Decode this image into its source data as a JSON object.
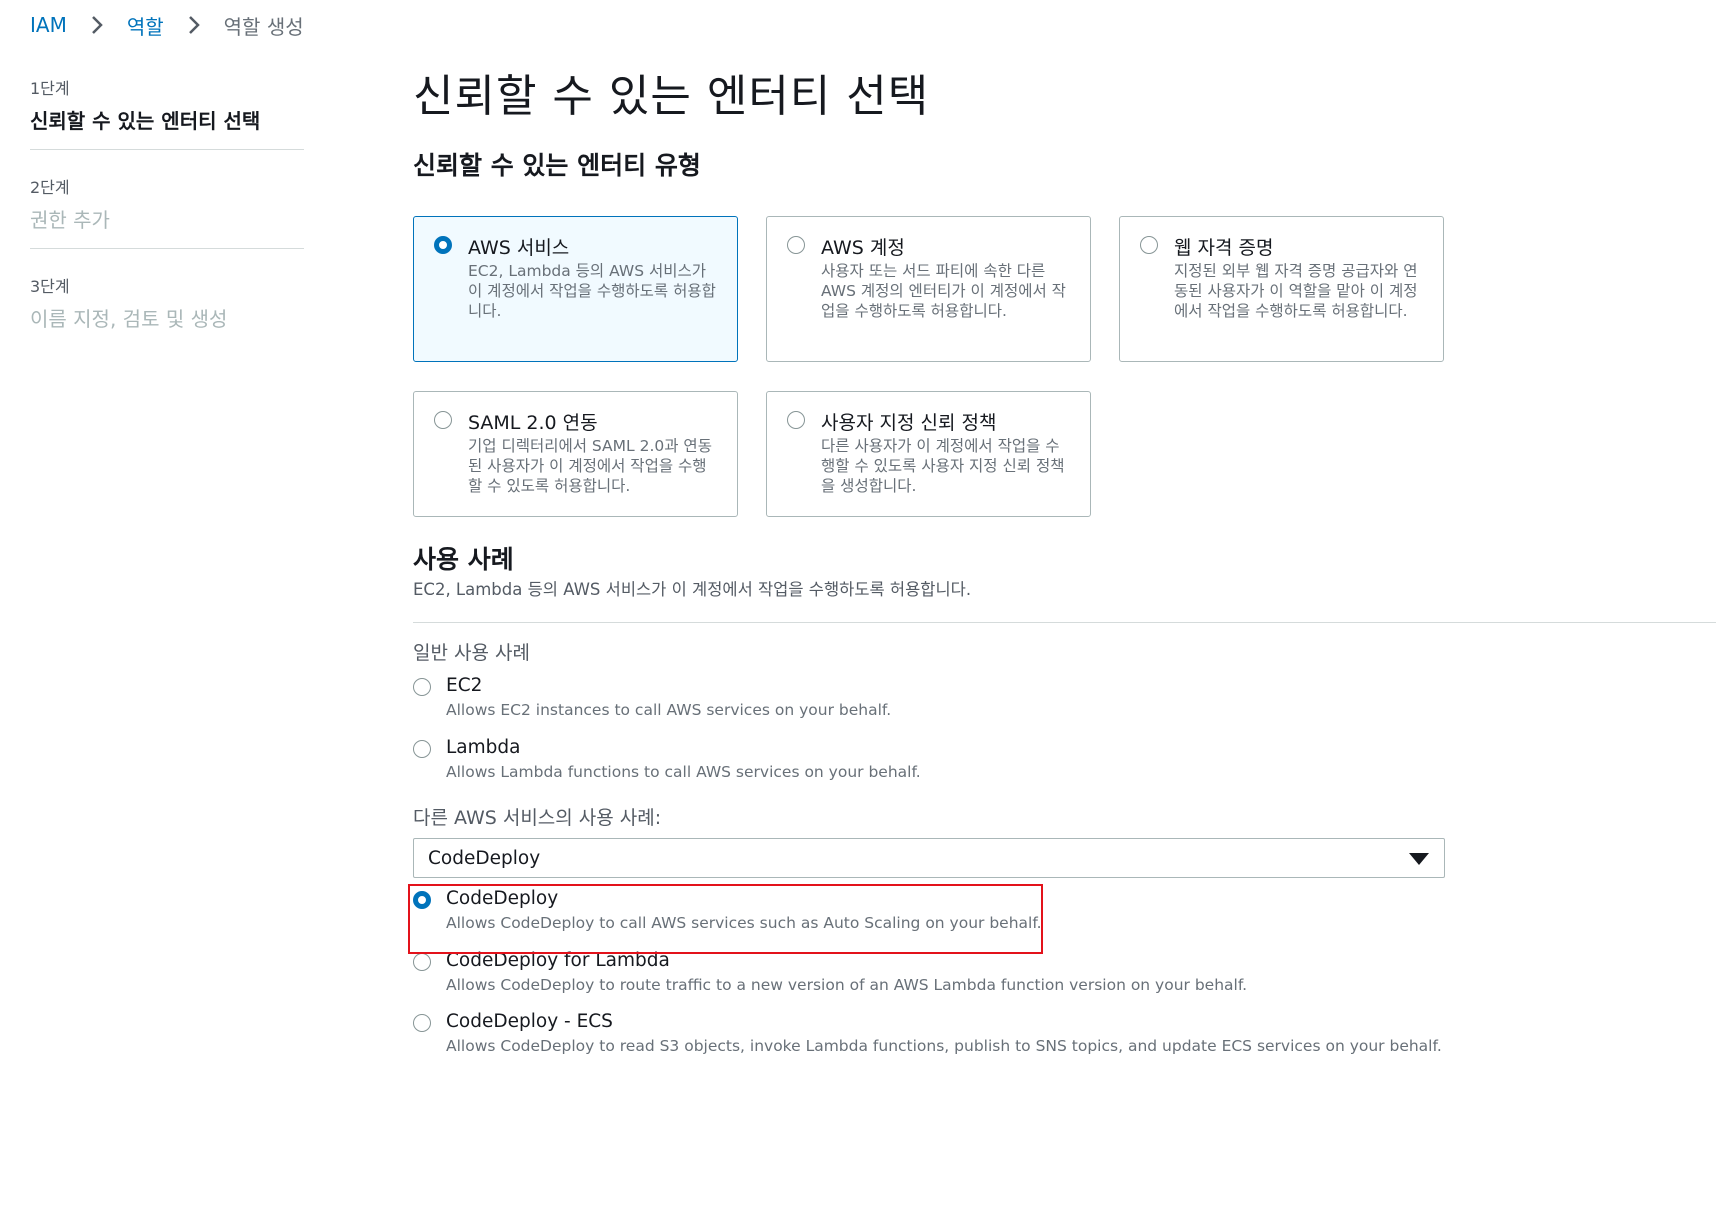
{
  "breadcrumb": {
    "items": [
      "IAM",
      "역할",
      "역할 생성"
    ]
  },
  "steps": [
    {
      "num": "1단계",
      "title": "신뢰할 수 있는 엔터티 선택",
      "active": true
    },
    {
      "num": "2단계",
      "title": "권한 추가",
      "active": false
    },
    {
      "num": "3단계",
      "title": "이름 지정, 검토 및 생성",
      "active": false
    }
  ],
  "page_title": "신뢰할 수 있는 엔터티 선택",
  "entity_section_title": "신뢰할 수 있는 엔터티 유형",
  "entity_tiles": [
    {
      "title": "AWS 서비스",
      "description": "EC2, Lambda 등의 AWS 서비스가 이 계정에서 작업을 수행하도록 허용합니다.",
      "selected": true
    },
    {
      "title": "AWS 계정",
      "description": "사용자 또는 서드 파티에 속한 다른 AWS 계정의 엔터티가 이 계정에서 작업을 수행하도록 허용합니다.",
      "selected": false
    },
    {
      "title": "웹 자격 증명",
      "description": "지정된 외부 웹 자격 증명 공급자와 연동된 사용자가 이 역할을 맡아 이 계정에서 작업을 수행하도록 허용합니다.",
      "selected": false
    },
    {
      "title": "SAML 2.0 연동",
      "description": "기업 디렉터리에서 SAML 2.0과 연동된 사용자가 이 계정에서 작업을 수행할 수 있도록 허용합니다.",
      "selected": false
    },
    {
      "title": "사용자 지정 신뢰 정책",
      "description": "다른 사용자가 이 계정에서 작업을 수행할 수 있도록 사용자 지정 신뢰 정책을 생성합니다.",
      "selected": false
    }
  ],
  "use_case": {
    "title": "사용 사례",
    "description": "EC2, Lambda 등의 AWS 서비스가 이 계정에서 작업을 수행하도록 허용합니다.",
    "common_label": "일반 사용 사례",
    "common_options": [
      {
        "title": "EC2",
        "description": "Allows EC2 instances to call AWS services on your behalf.",
        "selected": false
      },
      {
        "title": "Lambda",
        "description": "Allows Lambda functions to call AWS services on your behalf.",
        "selected": false
      }
    ],
    "other_label": "다른 AWS 서비스의 사용 사례:",
    "service_select": {
      "value": "CodeDeploy"
    },
    "service_options": [
      {
        "title": "CodeDeploy",
        "description": "Allows CodeDeploy to call AWS services such as Auto Scaling on your behalf.",
        "selected": true
      },
      {
        "title": "CodeDeploy for Lambda",
        "description": "Allows CodeDeploy to route traffic to a new version of an AWS Lambda function version on your behalf.",
        "selected": false
      },
      {
        "title": "CodeDeploy - ECS",
        "description": "Allows CodeDeploy to read S3 objects, invoke Lambda functions, publish to SNS topics, and update ECS services on your behalf.",
        "selected": false
      }
    ]
  },
  "colors": {
    "accent": "#0073bb",
    "highlight": "#e3121b",
    "muted_text": "#687078"
  }
}
